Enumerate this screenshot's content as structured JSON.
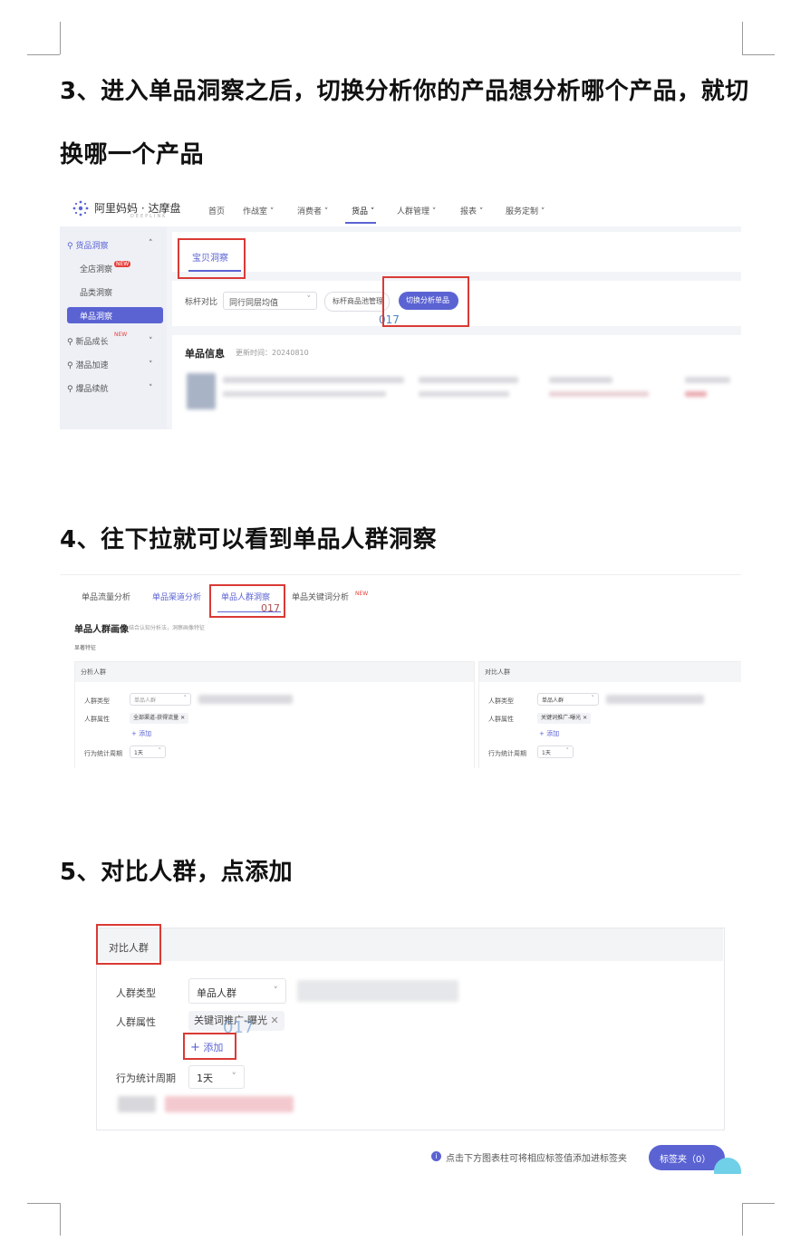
{
  "steps": {
    "s3_line1": "3、进入单品洞察之后，切换分析你的产品想分析哪个产品，就切",
    "s3_line2": "换哪一个产品",
    "s4": "4、往下拉就可以看到单品人群洞察",
    "s5": "5、对比人群，点添加"
  },
  "shot1": {
    "logo": "阿里妈妈 · 达摩盘",
    "logo_sub": "DEEPLINK",
    "nav": [
      "首页",
      "作战室",
      "消费者",
      "货品",
      "人群管理",
      "报表",
      "服务定制"
    ],
    "active_nav": "货品",
    "sidebar": {
      "group": "货品洞察",
      "items": [
        "全店洞察",
        "品类洞察",
        "单品洞察"
      ],
      "active": "单品洞察",
      "new_badge": "NEW",
      "others": [
        "新品成长",
        "潜品加速",
        "爆品续航"
      ]
    },
    "tab": "宝贝洞察",
    "filter_label": "标杆对比",
    "filter_value": "同行同层均值",
    "manage_btn": "标杆商品池管理",
    "switch_btn": "切换分析单品",
    "watermark": "017",
    "info_title": "单品信息",
    "update_time": "更新时间：20240810"
  },
  "shot2": {
    "tabs": [
      "单品流量分析",
      "单品渠道分析",
      "单品人群洞察",
      "单品关键词分析"
    ],
    "new_badge": "NEW",
    "watermark": "017",
    "section_title": "单品人群画像",
    "section_hint": "结合认知分析法，洞察画像特征",
    "sub_label": "显著特征",
    "left_panel": {
      "title": "分析人群",
      "type_label": "人群类型",
      "type_value": "单品人群",
      "attr_label": "人群属性",
      "attr_tag": "全部渠道-获得流量",
      "add": "+ 添加",
      "period_label": "行为统计周期",
      "period_value": "1天"
    },
    "right_panel": {
      "title": "对比人群",
      "type_label": "人群类型",
      "type_value": "单品人群",
      "attr_label": "人群属性",
      "attr_tag": "关键词推广-曝光",
      "add": "+ 添加",
      "period_label": "行为统计周期",
      "period_value": "1天"
    }
  },
  "shot3": {
    "panel_title": "对比人群",
    "type_label": "人群类型",
    "type_value": "单品人群",
    "attr_label": "人群属性",
    "attr_tag": "关键词推广-曝光",
    "add": "添加",
    "period_label": "行为统计周期",
    "period_value": "1天",
    "watermark": "017",
    "hint": "点击下方图表柱可将相应标签值添加进标签夹",
    "folder_btn": "标签夹（0）"
  },
  "colors": {
    "accent": "#5b63d3",
    "red_box": "#d93a35",
    "new_badge": "#e8403c"
  }
}
